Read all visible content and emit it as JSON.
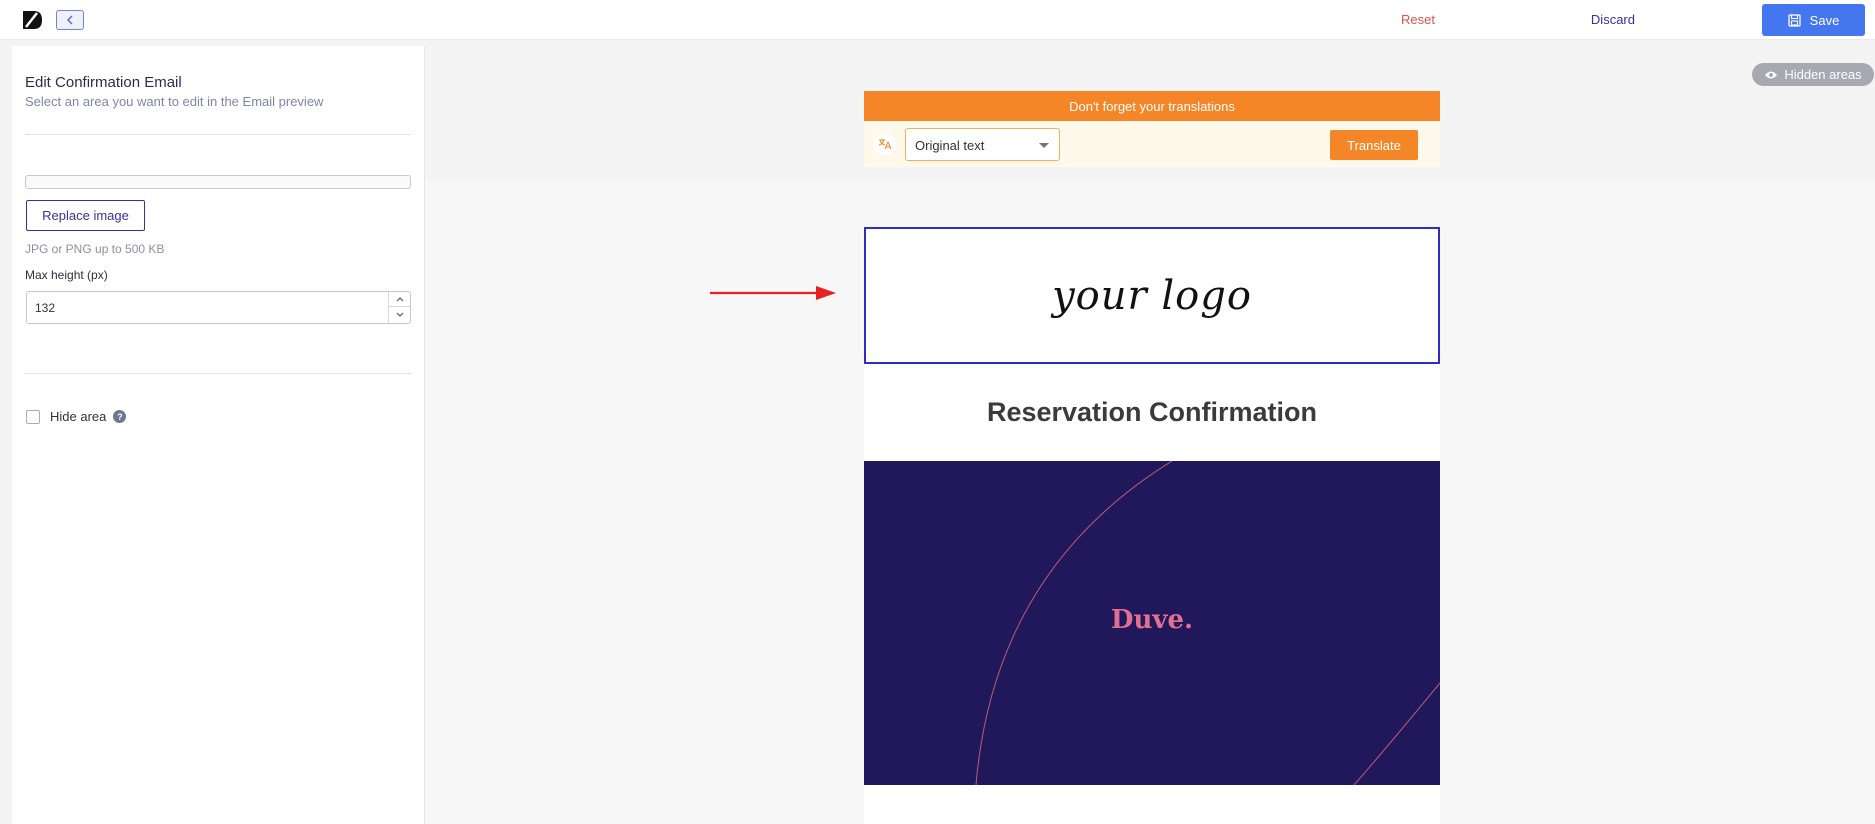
{
  "header": {
    "back_icon": "chevron-left-icon",
    "reset_label": "Reset",
    "discard_label": "Discard",
    "save_label": "Save",
    "save_icon": "floppy-disk-icon"
  },
  "sidebar": {
    "title": "Edit Confirmation Email",
    "subtitle": "Select an area you want to edit in the Email preview",
    "replace_image_label": "Replace image",
    "file_hint": "JPG or PNG up to 500 KB",
    "max_height_label": "Max height (px)",
    "max_height_value": "132",
    "hide_area_label": "Hide area",
    "help_glyph": "?"
  },
  "preview": {
    "hidden_areas_label": "Hidden areas",
    "translation_banner": "Don't forget your translations",
    "language_selected": "Original text",
    "translate_label": "Translate",
    "logo_placeholder": "your logo",
    "heading": "Reservation Confirmation",
    "brand_name": "Duve."
  },
  "colors": {
    "accent": "#4476f0",
    "brand_navy": "#21185b",
    "translation_orange": "#f58628",
    "selection_border": "#2f2bc6",
    "reset_red": "#e0524f",
    "brand_pink": "#e16f8f"
  }
}
